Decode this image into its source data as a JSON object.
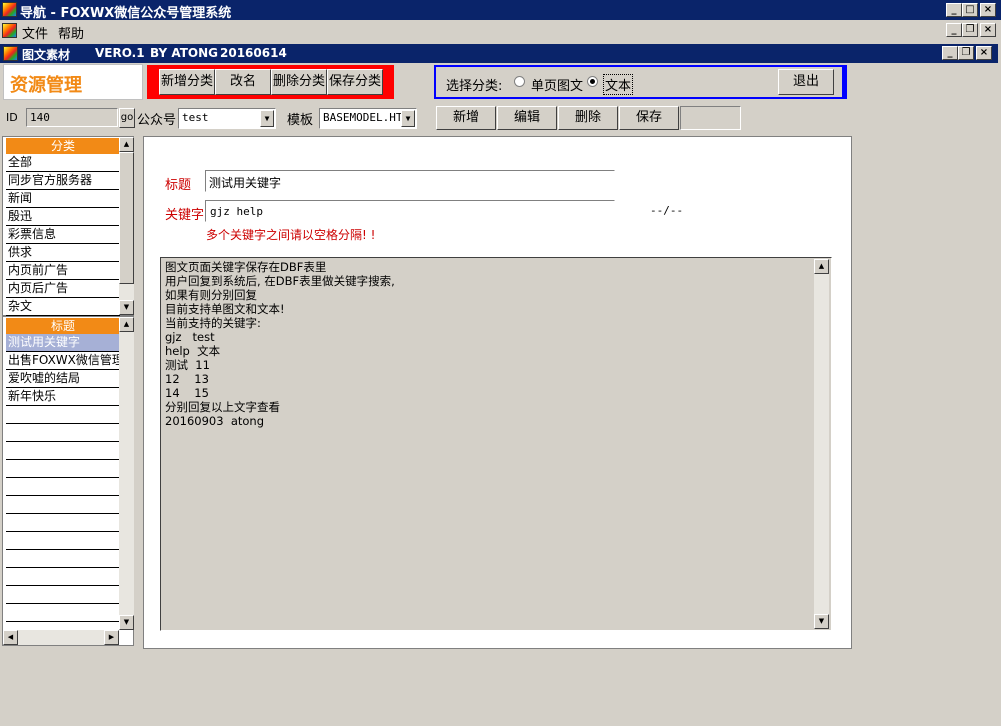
{
  "window": {
    "title": "导航 - FOXWX微信公众号管理系统"
  },
  "menu": {
    "items": [
      "文件",
      "帮助"
    ]
  },
  "child_window": {
    "title": "图文素材",
    "version": "VERO.1",
    "by": "BY ATONG",
    "date": "20160614"
  },
  "header": {
    "brand": "资源管理"
  },
  "category_toolbar": {
    "add": "新增分类",
    "rename": "改名",
    "delete": "删除分类",
    "save": "保存分类"
  },
  "select_category": {
    "label": "选择分类:",
    "option_single": "单页图文",
    "option_text": "文本",
    "selected": "文本"
  },
  "exit_label": "退出",
  "filter": {
    "id_label": "ID",
    "id_value": "140",
    "go_label": "go",
    "account_label": "公众号",
    "account_value": "test",
    "template_label": "模板",
    "template_value": "BASEMODEL.HTM"
  },
  "record_toolbar": {
    "add": "新增",
    "edit": "编辑",
    "delete": "删除",
    "save": "保存"
  },
  "categories": {
    "header": "分类",
    "items": [
      "全部",
      "同步官方服务器",
      "新闻",
      "殷迅",
      "彩票信息",
      "供求",
      "内页前广告",
      "内页后广告",
      "杂文"
    ]
  },
  "titles": {
    "header": "标题",
    "items": [
      "测试用关键字",
      "出售FOXWX微信管理平台",
      "爱吹嘘的结局",
      "新年快乐"
    ],
    "selected": 0
  },
  "form": {
    "title_label": "标题",
    "title_value": "测试用关键字",
    "keyword_label": "关键字",
    "keyword_value": "gjz help",
    "date_placeholder": "--/--",
    "hint": "多个关键字之间请以空格分隔! !",
    "content_lines": [
      "图文页面关键字保存在DBF表里",
      "用户回复到系统后, 在DBF表里做关键字搜索,",
      "如果有则分别回复",
      "目前支持单图文和文本!",
      "当前支持的关键字:",
      "gjz   test",
      "help  文本",
      "测试  11",
      "12    13",
      "14    15",
      "分别回复以上文字查看",
      "20160903  atong"
    ]
  },
  "colors": {
    "titlebar": "#0a246a",
    "accent_orange": "#f28a16",
    "red_box": "#ff0000",
    "blue_box": "#0000ff",
    "label_red": "#cc0000",
    "selected_row": "#a6b0d6"
  }
}
